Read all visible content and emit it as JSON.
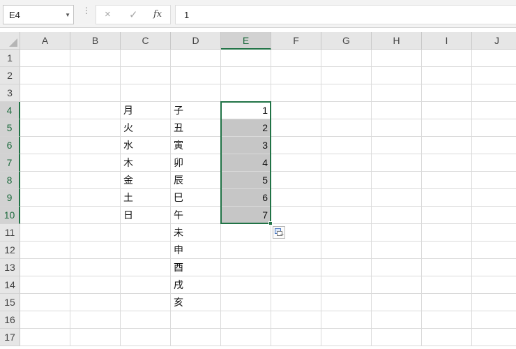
{
  "formula_bar": {
    "name_box": "E4",
    "cancel_icon": "×",
    "enter_icon": "✓",
    "fx_label": "fx",
    "formula": "1"
  },
  "columns": [
    "A",
    "B",
    "C",
    "D",
    "E",
    "F",
    "G",
    "H",
    "I",
    "J"
  ],
  "rows": [
    "1",
    "2",
    "3",
    "4",
    "5",
    "6",
    "7",
    "8",
    "9",
    "10",
    "11",
    "12",
    "13",
    "14",
    "15",
    "16",
    "17"
  ],
  "selected_column": "E",
  "selected_rows": [
    "4",
    "5",
    "6",
    "7",
    "8",
    "9",
    "10"
  ],
  "cells": {
    "C4": "月",
    "C5": "火",
    "C6": "水",
    "C7": "木",
    "C8": "金",
    "C9": "土",
    "C10": "日",
    "D4": "子",
    "D5": "丑",
    "D6": "寅",
    "D7": "卯",
    "D8": "辰",
    "D9": "巳",
    "D10": "午",
    "D11": "未",
    "D12": "申",
    "D13": "酉",
    "D14": "戌",
    "D15": "亥",
    "E4": "1",
    "E5": "2",
    "E6": "3",
    "E7": "4",
    "E8": "5",
    "E9": "6",
    "E10": "7"
  },
  "colors": {
    "accent": "#217346",
    "selection_fill": "#c6c6c6",
    "header_bg": "#e6e6e6",
    "gridline": "#dadada"
  },
  "icons": {
    "autofill_options": "auto-fill-options-icon",
    "name_box_dropdown": "chevron-down-icon"
  }
}
